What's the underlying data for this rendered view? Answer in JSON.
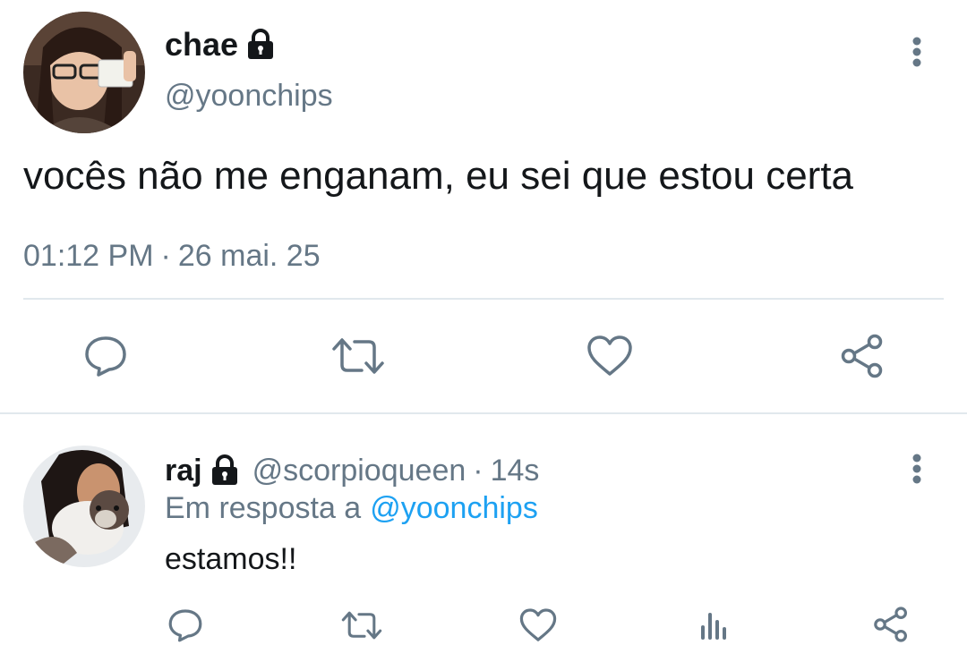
{
  "main_tweet": {
    "author_name": "chae",
    "handle": "@yoonchips",
    "text": "vocês não me enganam, eu sei que estou certa",
    "time": "01:12 PM",
    "separator": "·",
    "date": "26 mai. 25",
    "avatar_icon": "profile-photo",
    "lock_icon": "lock-icon",
    "more_icon": "more-vertical-icon",
    "actions": [
      "reply-icon",
      "retweet-icon",
      "like-icon",
      "share-icon"
    ]
  },
  "reply_tweet": {
    "author_name": "raj",
    "handle": "@scorpioqueen",
    "separator": "·",
    "age": "14s",
    "reply_prefix": "Em resposta a",
    "reply_to": "@yoonchips",
    "text": "estamos!!",
    "avatar_icon": "profile-photo",
    "lock_icon": "lock-icon",
    "more_icon": "more-vertical-icon",
    "actions": [
      "reply-icon",
      "retweet-icon",
      "like-icon",
      "analytics-icon",
      "share-icon"
    ]
  },
  "colors": {
    "text": "#14171a",
    "muted": "#657786",
    "link": "#1da1f2",
    "divider": "#e1e8ed"
  }
}
